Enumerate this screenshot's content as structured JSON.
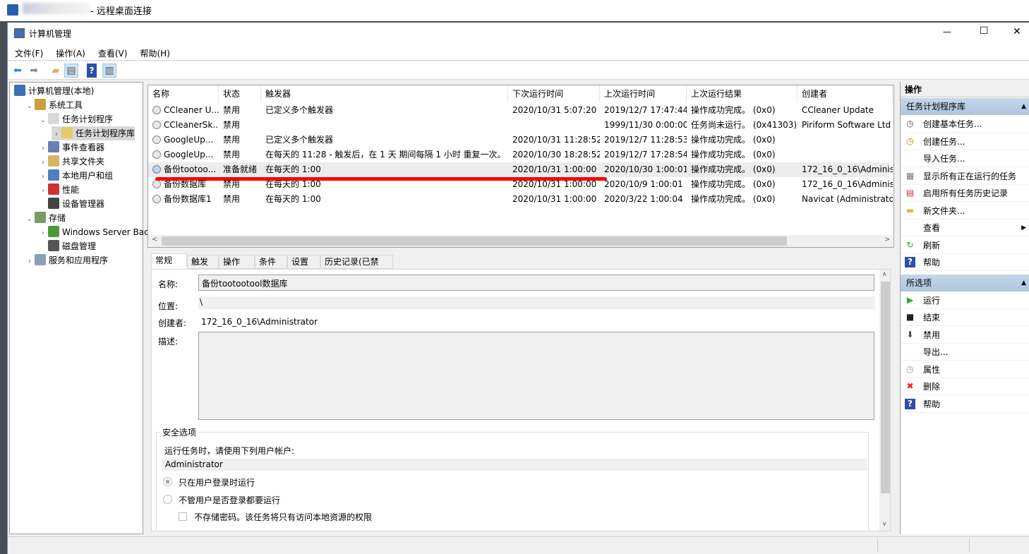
{
  "rdp": {
    "title": "- 远程桌面连接"
  },
  "window": {
    "title": "计算机管理",
    "minimize": "—",
    "maximize": "☐",
    "close": "✕"
  },
  "menu": [
    "文件(F)",
    "操作(A)",
    "查看(V)",
    "帮助(H)"
  ],
  "toolbar": {
    "icons": [
      "back-arrow-icon",
      "forward-arrow-icon",
      "up-folder-icon",
      "show-hide-tree-icon",
      "help-icon",
      "show-hide-action-pane-icon"
    ]
  },
  "tree": [
    {
      "label": "计算机管理(本地)",
      "level": 0,
      "chev": ""
    },
    {
      "label": "系统工具",
      "level": 1,
      "chev": "v"
    },
    {
      "label": "任务计划程序",
      "level": 2,
      "chev": "v"
    },
    {
      "label": "任务计划程序库",
      "level": 3,
      "chev": ">",
      "selected": true
    },
    {
      "label": "事件查看器",
      "level": 2,
      "chev": ">"
    },
    {
      "label": "共享文件夹",
      "level": 2,
      "chev": ">"
    },
    {
      "label": "本地用户和组",
      "level": 2,
      "chev": ">"
    },
    {
      "label": "性能",
      "level": 2,
      "chev": ">"
    },
    {
      "label": "设备管理器",
      "level": 2,
      "chev": ""
    },
    {
      "label": "存储",
      "level": 1,
      "chev": "v"
    },
    {
      "label": "Windows Server Back",
      "level": 2,
      "chev": ">"
    },
    {
      "label": "磁盘管理",
      "level": 2,
      "chev": ""
    },
    {
      "label": "服务和应用程序",
      "level": 1,
      "chev": ">"
    }
  ],
  "tasks": {
    "columns": [
      "名称",
      "状态",
      "触发器",
      "下次运行时间",
      "上次运行时间",
      "上次运行结果",
      "创建者"
    ],
    "rows": [
      [
        "CCleaner U...",
        "禁用",
        "已定义多个触发器",
        "2020/10/31 5:07:20",
        "2019/12/7 17:47:44",
        "操作成功完成。 (0x0)",
        "CCleaner Update"
      ],
      [
        "CCleanerSk...",
        "禁用",
        "",
        "",
        "1999/11/30 0:00:00",
        "任务尚未运行。 (0x41303)",
        "Piriform Software Ltd"
      ],
      [
        "GoogleUp...",
        "禁用",
        "已定义多个触发器",
        "2020/10/31 11:28:52",
        "2019/12/7 11:28:53",
        "操作成功完成。 (0x0)",
        ""
      ],
      [
        "GoogleUp...",
        "禁用",
        "在每天的 11:28 - 触发后，在 1 天 期间每隔 1 小时 重复一次。",
        "2020/10/30 18:28:52",
        "2019/12/7 17:28:54",
        "操作成功完成。 (0x0)",
        ""
      ],
      [
        "备份tootoo...",
        "准备就绪",
        "在每天的 1:00",
        "2020/10/31 1:00:00",
        "2020/10/30 1:00:01",
        "操作成功完成。 (0x0)",
        "172_16_0_16\\Administ"
      ],
      [
        "备份数据库",
        "禁用",
        "在每天的 1:00",
        "2020/10/31 1:00:00",
        "2020/10/9 1:00:01",
        "操作成功完成。 (0x0)",
        "172_16_0_16\\Administ"
      ],
      [
        "备份数据库1",
        "禁用",
        "在每天的 1:00",
        "2020/10/31 1:00:00",
        "2020/3/22 1:00:04",
        "操作成功完成。 (0x0)",
        "Navicat (Administrator"
      ]
    ],
    "selected_index": 4
  },
  "detail": {
    "tabs": [
      "常规",
      "触发器",
      "操作",
      "条件",
      "设置",
      "历史记录(已禁用)"
    ],
    "active_tab": "常规",
    "name_label": "名称:",
    "name_value": "备份tootootool数据库",
    "location_label": "位置:",
    "location_value": "\\",
    "author_label": "创建者:",
    "author_value": "172_16_0_16\\Administrator",
    "desc_label": "描述:",
    "desc_value": "",
    "security": {
      "title": "安全选项",
      "run_as_label": "运行任务时，请使用下列用户帐户:",
      "user": "Administrator",
      "radio1": "只在用户登录时运行",
      "radio2": "不管用户是否登录都要运行",
      "checkbox": "不存储密码。该任务将只有访问本地资源的权限",
      "radio_selected": 1
    }
  },
  "actions": {
    "header": "操作",
    "sections": [
      {
        "title": "任务计划程序库",
        "items": [
          {
            "label": "创建基本任务...",
            "icon": "create-basic-task-icon"
          },
          {
            "label": "创建任务...",
            "icon": "create-task-icon"
          },
          {
            "label": "导入任务...",
            "icon": ""
          },
          {
            "label": "显示所有正在运行的任务",
            "icon": "running-tasks-icon"
          },
          {
            "label": "启用所有任务历史记录",
            "icon": "history-icon"
          },
          {
            "label": "新文件夹...",
            "icon": "new-folder-icon"
          },
          {
            "label": "查看",
            "icon": "",
            "submenu": true
          },
          {
            "label": "刷新",
            "icon": "refresh-icon"
          },
          {
            "label": "帮助",
            "icon": "help-icon"
          }
        ]
      },
      {
        "title": "所选项",
        "items": [
          {
            "label": "运行",
            "icon": "run-icon"
          },
          {
            "label": "结束",
            "icon": "stop-icon"
          },
          {
            "label": "禁用",
            "icon": "disable-icon"
          },
          {
            "label": "导出...",
            "icon": ""
          },
          {
            "label": "属性",
            "icon": "properties-icon"
          },
          {
            "label": "删除",
            "icon": "delete-icon"
          },
          {
            "label": "帮助",
            "icon": "help-icon"
          }
        ]
      }
    ]
  },
  "colors": {
    "highlight_line": "#ff0000",
    "section_header": "#bcd0e6"
  }
}
